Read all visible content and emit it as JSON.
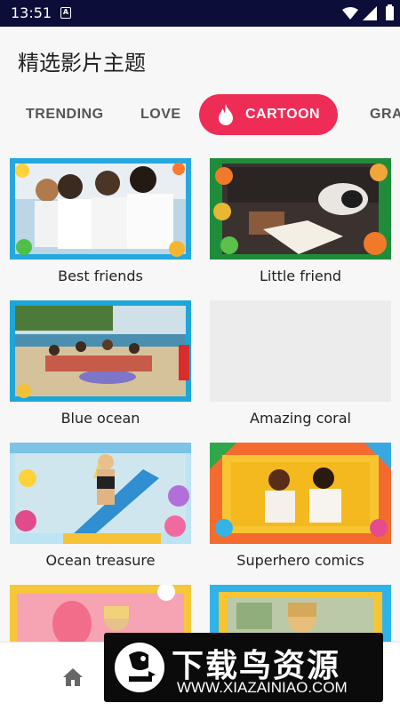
{
  "status_bar": {
    "time": "13:51",
    "notification_icon": "A"
  },
  "header": {
    "title": "精选影片主题"
  },
  "tabs": [
    {
      "label": "TRENDING",
      "active": false
    },
    {
      "label": "LOVE",
      "active": false
    },
    {
      "label": "CARTOON",
      "active": true,
      "icon": "fire-icon"
    },
    {
      "label": "GRA",
      "active": false
    }
  ],
  "colors": {
    "accent": "#ef2c55",
    "status_bar": "#0d0d3a"
  },
  "templates": [
    {
      "title": "Best friends"
    },
    {
      "title": "Little friend"
    },
    {
      "title": "Blue ocean"
    },
    {
      "title": "Amazing coral"
    },
    {
      "title": "Ocean treasure"
    },
    {
      "title": "Superhero comics"
    },
    {
      "title": ""
    },
    {
      "title": ""
    }
  ],
  "bottom_nav": {
    "home_icon": "home-icon"
  },
  "watermark": {
    "title": "下载鸟资源",
    "url": "WWW.XIAZAINIAO.COM"
  }
}
